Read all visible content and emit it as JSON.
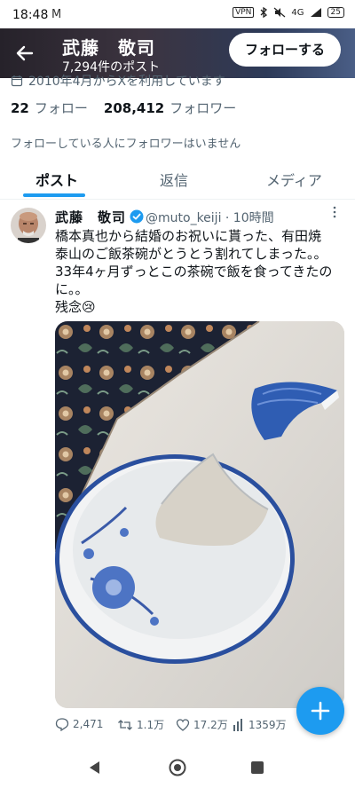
{
  "status_bar": {
    "time": "18:48",
    "mail_icon": "M",
    "vpn": "VPN",
    "network": "4G",
    "battery": "25"
  },
  "header": {
    "name": "武藤　敬司",
    "posts_count": "7,294件のポスト",
    "follow_label": "フォローする"
  },
  "profile": {
    "joined": "2010年4月からXを利用しています",
    "following_count": "22",
    "following_label": "フォロー",
    "followers_count": "208,412",
    "followers_label": "フォロワー",
    "no_mutual": "フォローしている人にフォロワーはいません"
  },
  "tabs": [
    {
      "label": "ポスト",
      "active": true
    },
    {
      "label": "返信"
    },
    {
      "label": "メディア"
    }
  ],
  "tweet": {
    "name": "武藤　敬司",
    "handle": "@muto_keiji · 10時間",
    "lines": [
      "橋本真也から結婚のお祝いに貰った、有田焼",
      "泰山のご飯茶碗がとうとう割れてしまった。。",
      "33年4ヶ月ずっとこの茶碗で飯を食ってきたの",
      "に。。",
      "残念😢"
    ],
    "replies": "2,471",
    "reposts": "1.1万",
    "likes": "17.2万",
    "views": "1359万"
  },
  "colors": {
    "accent": "#1d9bf0",
    "text": "#0f1419",
    "muted": "#536471"
  },
  "icons": [
    "back-arrow-icon",
    "calendar-icon",
    "verified-badge-icon",
    "more-icon",
    "reply-icon",
    "repost-icon",
    "like-icon",
    "views-icon",
    "compose-plus-icon",
    "nav-back-icon",
    "nav-home-icon",
    "nav-recents-icon"
  ]
}
